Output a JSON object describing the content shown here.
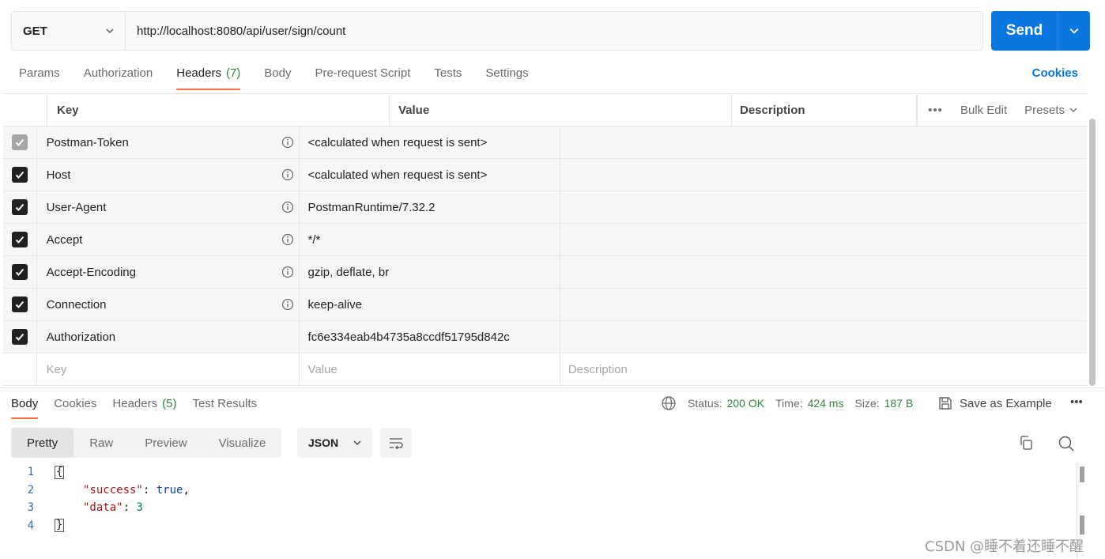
{
  "request": {
    "method": "GET",
    "url": "http://localhost:8080/api/user/sign/count",
    "send_label": "Send"
  },
  "request_tabs": [
    {
      "label": "Params"
    },
    {
      "label": "Authorization"
    },
    {
      "label": "Headers",
      "count": "(7)",
      "active": true
    },
    {
      "label": "Body"
    },
    {
      "label": "Pre-request Script"
    },
    {
      "label": "Tests"
    },
    {
      "label": "Settings"
    }
  ],
  "cookies_label": "Cookies",
  "headers_table": {
    "columns": {
      "key": "Key",
      "value": "Value",
      "description": "Description"
    },
    "tools": {
      "bulk_edit": "Bulk Edit",
      "presets": "Presets"
    },
    "rows": [
      {
        "key": "Postman-Token",
        "value": "<calculated when request is sent>",
        "checked": true,
        "disabled": true,
        "info": true
      },
      {
        "key": "Host",
        "value": "<calculated when request is sent>",
        "checked": true,
        "info": true
      },
      {
        "key": "User-Agent",
        "value": "PostmanRuntime/7.32.2",
        "checked": true,
        "info": true
      },
      {
        "key": "Accept",
        "value": "*/*",
        "checked": true,
        "info": true
      },
      {
        "key": "Accept-Encoding",
        "value": "gzip, deflate, br",
        "checked": true,
        "info": true
      },
      {
        "key": "Connection",
        "value": "keep-alive",
        "checked": true,
        "info": true
      },
      {
        "key": "Authorization",
        "value": "fc6e334eab4b4735a8ccdf51795d842c",
        "checked": true,
        "info": false
      }
    ],
    "placeholders": {
      "key": "Key",
      "value": "Value",
      "description": "Description"
    }
  },
  "response_tabs": [
    {
      "label": "Body",
      "active": true
    },
    {
      "label": "Cookies"
    },
    {
      "label": "Headers",
      "count": "(5)"
    },
    {
      "label": "Test Results"
    }
  ],
  "response_status": {
    "status_label": "Status:",
    "status": "200 OK",
    "time_label": "Time:",
    "time": "424 ms",
    "size_label": "Size:",
    "size": "187 B"
  },
  "save_example_label": "Save as Example",
  "view_modes": [
    "Pretty",
    "Raw",
    "Preview",
    "Visualize"
  ],
  "format": "JSON",
  "code_lines": [
    {
      "n": "1"
    },
    {
      "n": "2",
      "key": "\"success\"",
      "val": "true"
    },
    {
      "n": "3",
      "key": "\"data\"",
      "val": "3"
    },
    {
      "n": "4"
    }
  ],
  "watermark": "CSDN @睡不着还睡不醒",
  "colors": {
    "accent": "#0b76e0",
    "tab_underline": "#ff6c37",
    "success": "#2e8540"
  }
}
